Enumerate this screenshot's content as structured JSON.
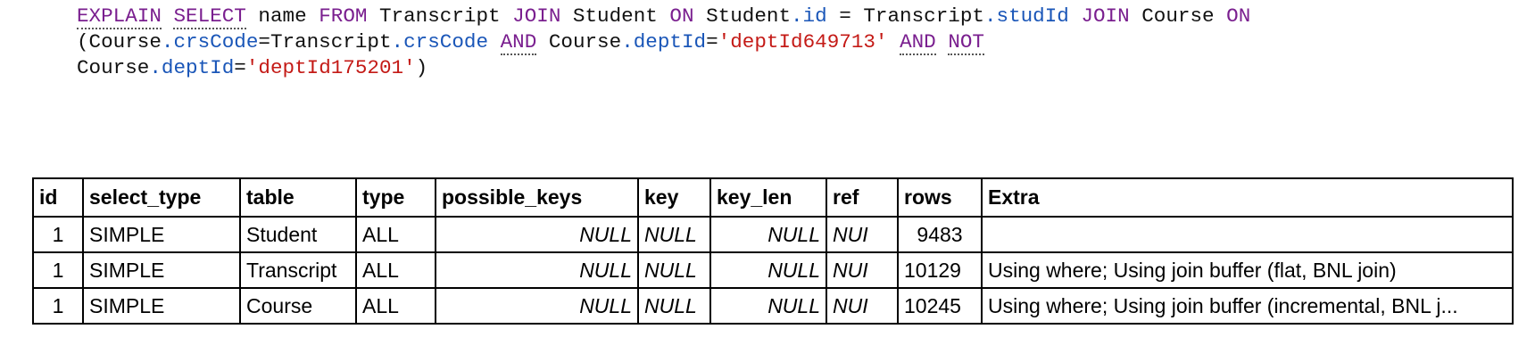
{
  "query": {
    "line1": {
      "kw_explain": "EXPLAIN",
      "kw_select": "SELECT",
      "t_name": " name ",
      "kw_from": "FROM",
      "t_transcript": " Transcript ",
      "kw_join1": "JOIN",
      "t_student": " Student ",
      "kw_on1": "ON",
      "t_student2": " Student",
      "p_id": ".id",
      "t_eq": " = Transcript",
      "p_studid": ".studId",
      "t_sp1": " ",
      "kw_join2": "JOIN",
      "t_course": " Course ",
      "kw_on2": "ON"
    },
    "line2": {
      "t_paren": "(Course",
      "p_crscode1": ".crsCode",
      "t_eq_transcript": "=Transcript",
      "p_crscode2": ".crsCode",
      "t_sp1": " ",
      "kw_and": "AND",
      "t_course": " Course",
      "p_deptid": ".deptId",
      "t_eq": "=",
      "s_dept1": "'deptId649713'",
      "t_sp2": " ",
      "kw_and2": "AND",
      "t_sp3": " ",
      "kw_not": "NOT"
    },
    "line3": {
      "t_course": "Course",
      "p_deptid": ".deptId",
      "t_eq": "=",
      "s_dept2": "'deptId175201'",
      "t_close": ")"
    }
  },
  "table": {
    "headers": [
      "id",
      "select_type",
      "table",
      "type",
      "possible_keys",
      "key",
      "key_len",
      "ref",
      "rows",
      "Extra"
    ],
    "rows": [
      {
        "id": "1",
        "select_type": "SIMPLE",
        "table": "Student",
        "type": "ALL",
        "possible_keys": "NULL",
        "key": "NULL",
        "key_len": "NULL",
        "ref": "NUI",
        "rows": "9483",
        "extra": ""
      },
      {
        "id": "1",
        "select_type": "SIMPLE",
        "table": "Transcript",
        "type": "ALL",
        "possible_keys": "NULL",
        "key": "NULL",
        "key_len": "NULL",
        "ref": "NUI",
        "rows": "10129",
        "extra": "Using where; Using join buffer (flat, BNL join)"
      },
      {
        "id": "1",
        "select_type": "SIMPLE",
        "table": "Course",
        "type": "ALL",
        "possible_keys": "NULL",
        "key": "NULL",
        "key_len": "NULL",
        "ref": "NUI",
        "rows": "10245",
        "extra": "Using where; Using join buffer (incremental, BNL j..."
      }
    ]
  },
  "colors": {
    "keyword": "#7a1f8f",
    "property": "#1a56b8",
    "string": "#c41a16"
  }
}
